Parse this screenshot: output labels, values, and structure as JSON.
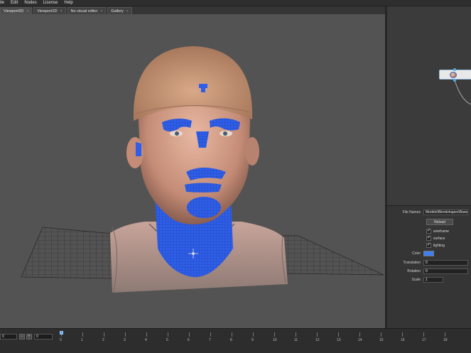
{
  "menu": [
    "ile",
    "Edit",
    "Nodes",
    "License",
    "Help"
  ],
  "tabs": [
    {
      "label": "Viewport3D",
      "active": true
    },
    {
      "label": "Viewport2D",
      "active": false
    },
    {
      "label": "No visual editor",
      "active": false
    },
    {
      "label": "Gallery",
      "active": false
    }
  ],
  "tab_close_glyph": "×",
  "properties": {
    "file_names_label": "File Names",
    "file_names_value": "Models\\Blendshapes\\Basemod",
    "reload_label": "Reload",
    "checkboxes": [
      {
        "label": "wireframe",
        "checked": true
      },
      {
        "label": "surface",
        "checked": true
      },
      {
        "label": "lighting",
        "checked": true
      }
    ],
    "check_glyph": "✓",
    "color_label": "Color",
    "color_value": "#3d7ff0",
    "translation_label": "Translation",
    "translation_value": "0",
    "rotation_label": "Rotation",
    "rotation_value": "0",
    "scale_label": "Scale",
    "scale_value": "1"
  },
  "timeline": {
    "start_value": "0",
    "minus_label": "−",
    "plus_label": "+",
    "end_value": "0",
    "ticks": [
      "0",
      "1",
      "2",
      "3",
      "4",
      "5",
      "6",
      "7",
      "8",
      "9",
      "10",
      "11",
      "12",
      "13",
      "14",
      "15",
      "16",
      "17",
      "18"
    ]
  },
  "colors": {
    "mesh_blue": "#2f5fe8",
    "viewport_bg": "#535353",
    "accent": "#3d7ff0"
  }
}
